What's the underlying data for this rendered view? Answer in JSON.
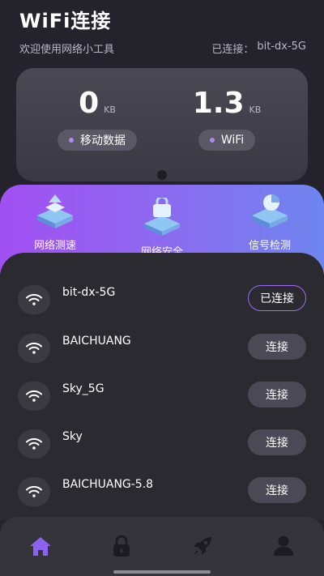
{
  "header": {
    "title": "WiFi连接",
    "welcome": "欢迎使用网络小工具",
    "connected_label": "已连接：",
    "connected_ssid": "bit-dx-5G"
  },
  "stats": {
    "mobile": {
      "value": "0",
      "unit": "KB",
      "label": "移动数据"
    },
    "wifi": {
      "value": "1.3",
      "unit": "KB",
      "label": "WiFi"
    }
  },
  "quick_actions": [
    {
      "label": "网络测速",
      "icon": "speed-test-icon"
    },
    {
      "label": "网络安全",
      "icon": "network-security-icon"
    },
    {
      "label": "信号检测",
      "icon": "signal-detection-icon"
    }
  ],
  "networks": [
    {
      "ssid": "bit-dx-5G",
      "action": "已连接",
      "connected": true
    },
    {
      "ssid": "BAICHUANG",
      "action": "连接",
      "connected": false
    },
    {
      "ssid": "Sky_5G",
      "action": "连接",
      "connected": false
    },
    {
      "ssid": "Sky",
      "action": "连接",
      "connected": false
    },
    {
      "ssid": "BAICHUANG-5.8",
      "action": "连接",
      "connected": false
    }
  ],
  "tabs": [
    {
      "name": "home",
      "icon": "home-icon",
      "active": true
    },
    {
      "name": "security",
      "icon": "lock-icon",
      "active": false
    },
    {
      "name": "speed",
      "icon": "rocket-icon",
      "active": false
    },
    {
      "name": "profile",
      "icon": "user-icon",
      "active": false
    }
  ],
  "colors": {
    "background": "#24232b",
    "accent_purple": "#a24ff2",
    "accent_blue": "#6e86ef",
    "tab_active": "#8a63f0"
  }
}
